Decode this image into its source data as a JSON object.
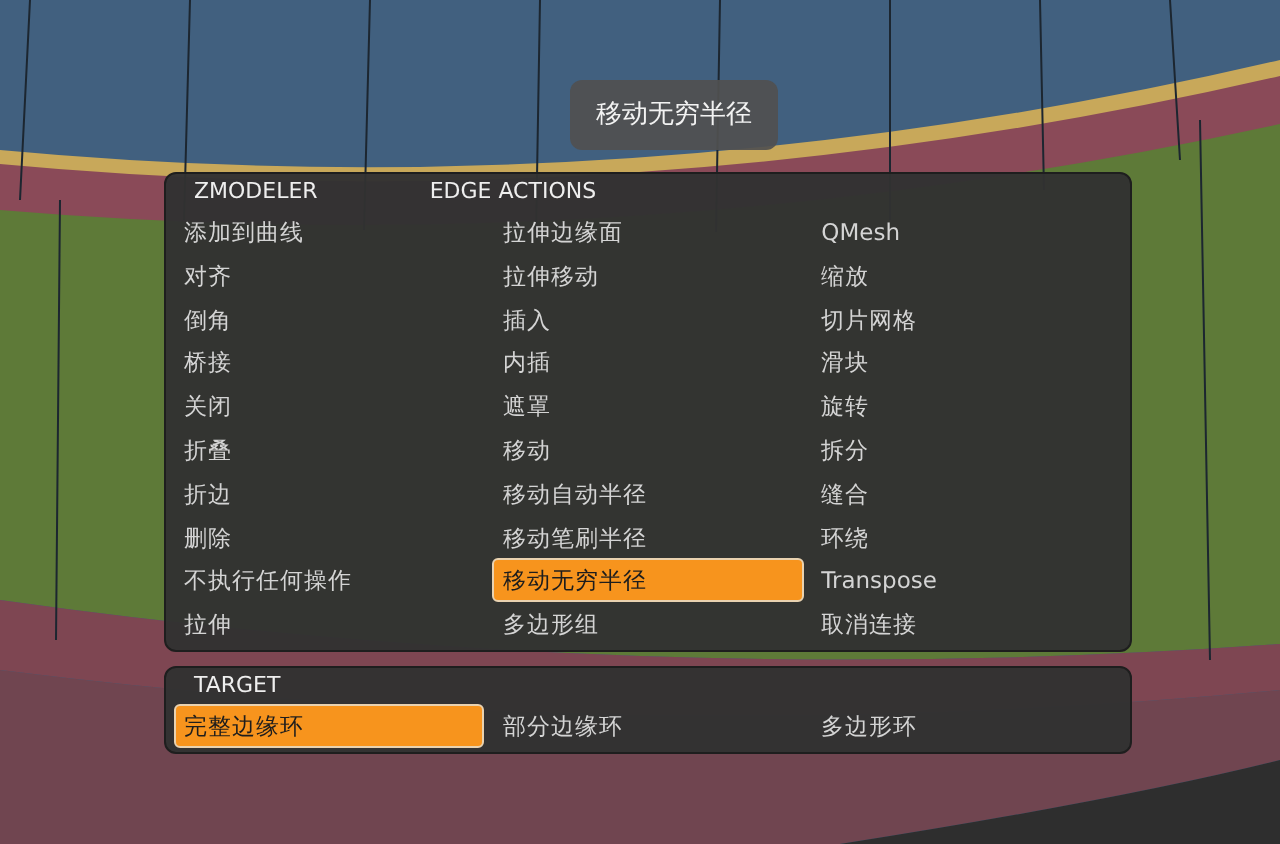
{
  "tooltip": {
    "label": "移动无穷半径"
  },
  "actions_panel": {
    "headings": [
      "ZMODELER",
      "EDGE ACTIONS"
    ],
    "columns": [
      [
        {
          "label": "添加到曲线",
          "selected": false
        },
        {
          "label": "对齐",
          "selected": false
        },
        {
          "label": "倒角",
          "selected": false
        },
        {
          "label": "桥接",
          "selected": false
        },
        {
          "label": "关闭",
          "selected": false
        },
        {
          "label": "折叠",
          "selected": false
        },
        {
          "label": "折边",
          "selected": false
        },
        {
          "label": "删除",
          "selected": false
        },
        {
          "label": "不执行任何操作",
          "selected": false
        },
        {
          "label": "拉伸",
          "selected": false
        }
      ],
      [
        {
          "label": "拉伸边缘面",
          "selected": false
        },
        {
          "label": "拉伸移动",
          "selected": false
        },
        {
          "label": "插入",
          "selected": false
        },
        {
          "label": "内插",
          "selected": false
        },
        {
          "label": "遮罩",
          "selected": false
        },
        {
          "label": "移动",
          "selected": false
        },
        {
          "label": "移动自动半径",
          "selected": false
        },
        {
          "label": "移动笔刷半径",
          "selected": false
        },
        {
          "label": "移动无穷半径",
          "selected": true
        },
        {
          "label": "多边形组",
          "selected": false
        }
      ],
      [
        {
          "label": "QMesh",
          "selected": false
        },
        {
          "label": "缩放",
          "selected": false
        },
        {
          "label": "切片网格",
          "selected": false
        },
        {
          "label": "滑块",
          "selected": false
        },
        {
          "label": "旋转",
          "selected": false
        },
        {
          "label": "拆分",
          "selected": false
        },
        {
          "label": "缝合",
          "selected": false
        },
        {
          "label": "环绕",
          "selected": false
        },
        {
          "label": "Transpose",
          "selected": false
        },
        {
          "label": "取消连接",
          "selected": false
        }
      ]
    ]
  },
  "target_panel": {
    "heading": "TARGET",
    "items": [
      {
        "label": "完整边缘环",
        "selected": true
      },
      {
        "label": "部分边缘环",
        "selected": false
      },
      {
        "label": "多边形环",
        "selected": false
      }
    ]
  }
}
